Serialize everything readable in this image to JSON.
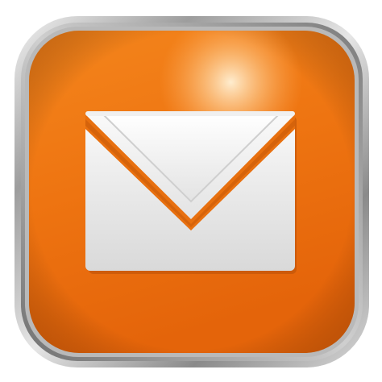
{
  "app_icon": {
    "icon": "mail-envelope-icon",
    "colors": {
      "accent": "#f07a12",
      "frame": "#9a9a9a",
      "envelope": "#e9e9e9",
      "background": "#ffffff"
    }
  }
}
